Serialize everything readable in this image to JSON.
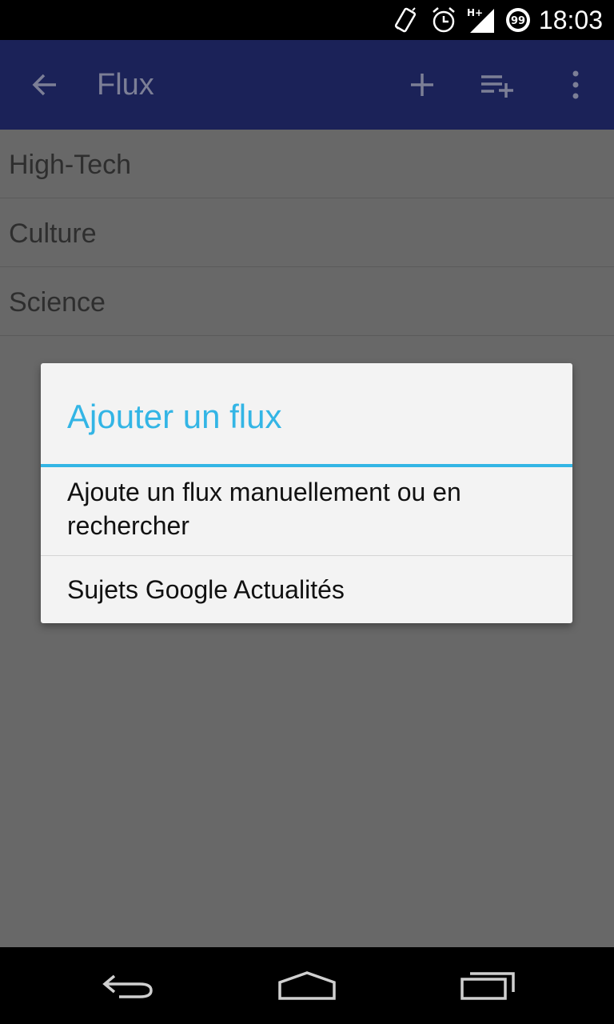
{
  "status_bar": {
    "time": "18:03",
    "network_label": "H+",
    "battery_level": "99",
    "icons": [
      "vibrate-icon",
      "alarm-icon",
      "signal-icon",
      "battery-icon"
    ]
  },
  "action_bar": {
    "title": "Flux",
    "icons": [
      "back-arrow-icon",
      "add-icon",
      "add-to-list-icon",
      "overflow-menu-icon"
    ]
  },
  "feeds": [
    {
      "label": "High-Tech"
    },
    {
      "label": "Culture"
    },
    {
      "label": "Science"
    }
  ],
  "dialog": {
    "title": "Ajouter un flux",
    "options": [
      {
        "label": "Ajoute un flux manuellement ou en rechercher"
      },
      {
        "label": "Sujets Google Actualités"
      }
    ]
  },
  "nav_bar": {
    "icons": [
      "back-icon",
      "home-icon",
      "recent-apps-icon"
    ]
  },
  "colors": {
    "action_bar": "#1b2258",
    "accent": "#33b5e5",
    "scrim": "#686868",
    "dialog_bg": "#f3f3f3"
  }
}
